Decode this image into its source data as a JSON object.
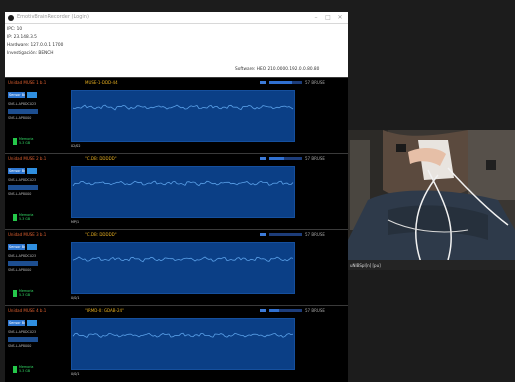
{
  "window": {
    "title": "EmotivBrainRecorder (Login)",
    "icon": "app-circle-icon",
    "controls": [
      "–",
      "□",
      "✕"
    ]
  },
  "info": {
    "lines": [
      "IPC: 10",
      "IP: 23.148.3.5",
      "Hardware: 127.0.0.1 1700",
      "Investigación: BENCH"
    ],
    "firmware": "Software: HEO 210.0000.192.0.0.80.80"
  },
  "panels": [
    {
      "device": "Unidad MUSE 1 b.1",
      "quality": "MUSE-1-DDD-44",
      "signal_button": "Sensor Bury",
      "row1": "SNS.L.AP8",
      "row1_val": "DC023",
      "row2": "SNS.L.AP8",
      "row2_val": "000",
      "x_axis": "02/02",
      "battery_percent": 70,
      "battery_text": "57 BRUSE",
      "memory_label": "Memoria",
      "memory_value": "5.3 GB"
    },
    {
      "device": "Unidad MUSE 2 b.1",
      "quality": "\"C.DB: DDDDD\"",
      "signal_button": "Sensor Bury",
      "row1": "SNS.L.AP8",
      "row1_val": "DC023",
      "row2": "SNS.L.AP8",
      "row2_val": "000",
      "x_axis": "MP/1",
      "battery_percent": 45,
      "battery_text": "57 BRUSE",
      "memory_label": "Memoria",
      "memory_value": "5.3 GB"
    },
    {
      "device": "Unidad MUSE 3 b.1",
      "quality": "\"C.DB: DDDDD\"",
      "signal_button": "Sensor Bury",
      "row1": "SNS.L.AP8",
      "row1_val": "DC023",
      "row2": "SNS.L.AP8",
      "row2_val": "000",
      "x_axis": "0/0/1",
      "battery_percent": 0,
      "battery_text": "57 BRUSE",
      "memory_label": "Memoria",
      "memory_value": "5.3 GB"
    },
    {
      "device": "Unidad MUSE 4 b.1",
      "quality": "\"IRMD-0: GDAB-24\"",
      "signal_button": "Sensor Bury",
      "row1": "SNS.L.AP8",
      "row1_val": "DC023",
      "row2": "SNS.L.AP8",
      "row2_val": "000",
      "x_axis": "0/0/1",
      "battery_percent": 30,
      "battery_text": "57 BRUSE",
      "memory_label": "Memoria",
      "memory_value": "5.3 GB"
    }
  ],
  "video": {
    "caption": "uNIBSpl[n] [pu]"
  },
  "colors": {
    "chart_bg": "#0b3f86",
    "signal_line": "#5aa0e8",
    "device_name": "#e06030",
    "quality_text": "#e8b020",
    "memory_ok": "#25c84a"
  }
}
